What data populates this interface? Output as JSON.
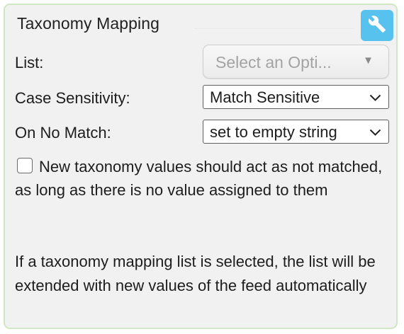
{
  "panel": {
    "title": "Taxonomy Mapping",
    "settings_icon": "wrench-icon",
    "accent_color": "#57c2ee",
    "border_color": "#cfe8c2"
  },
  "fields": {
    "list": {
      "label": "List:",
      "placeholder": "Select an Opti...",
      "disabled": true
    },
    "case_sensitivity": {
      "label": "Case Sensitivity:",
      "value": "Match Sensitive"
    },
    "on_no_match": {
      "label": "On No Match:",
      "value": "set to empty string"
    }
  },
  "new_values_checkbox": {
    "checked": false,
    "label": "New taxonomy values should act as not matched, as long as there is no value assigned to them"
  },
  "info_text": "If a taxonomy mapping list is selected, the list will be extended with new values of the feed automatically"
}
